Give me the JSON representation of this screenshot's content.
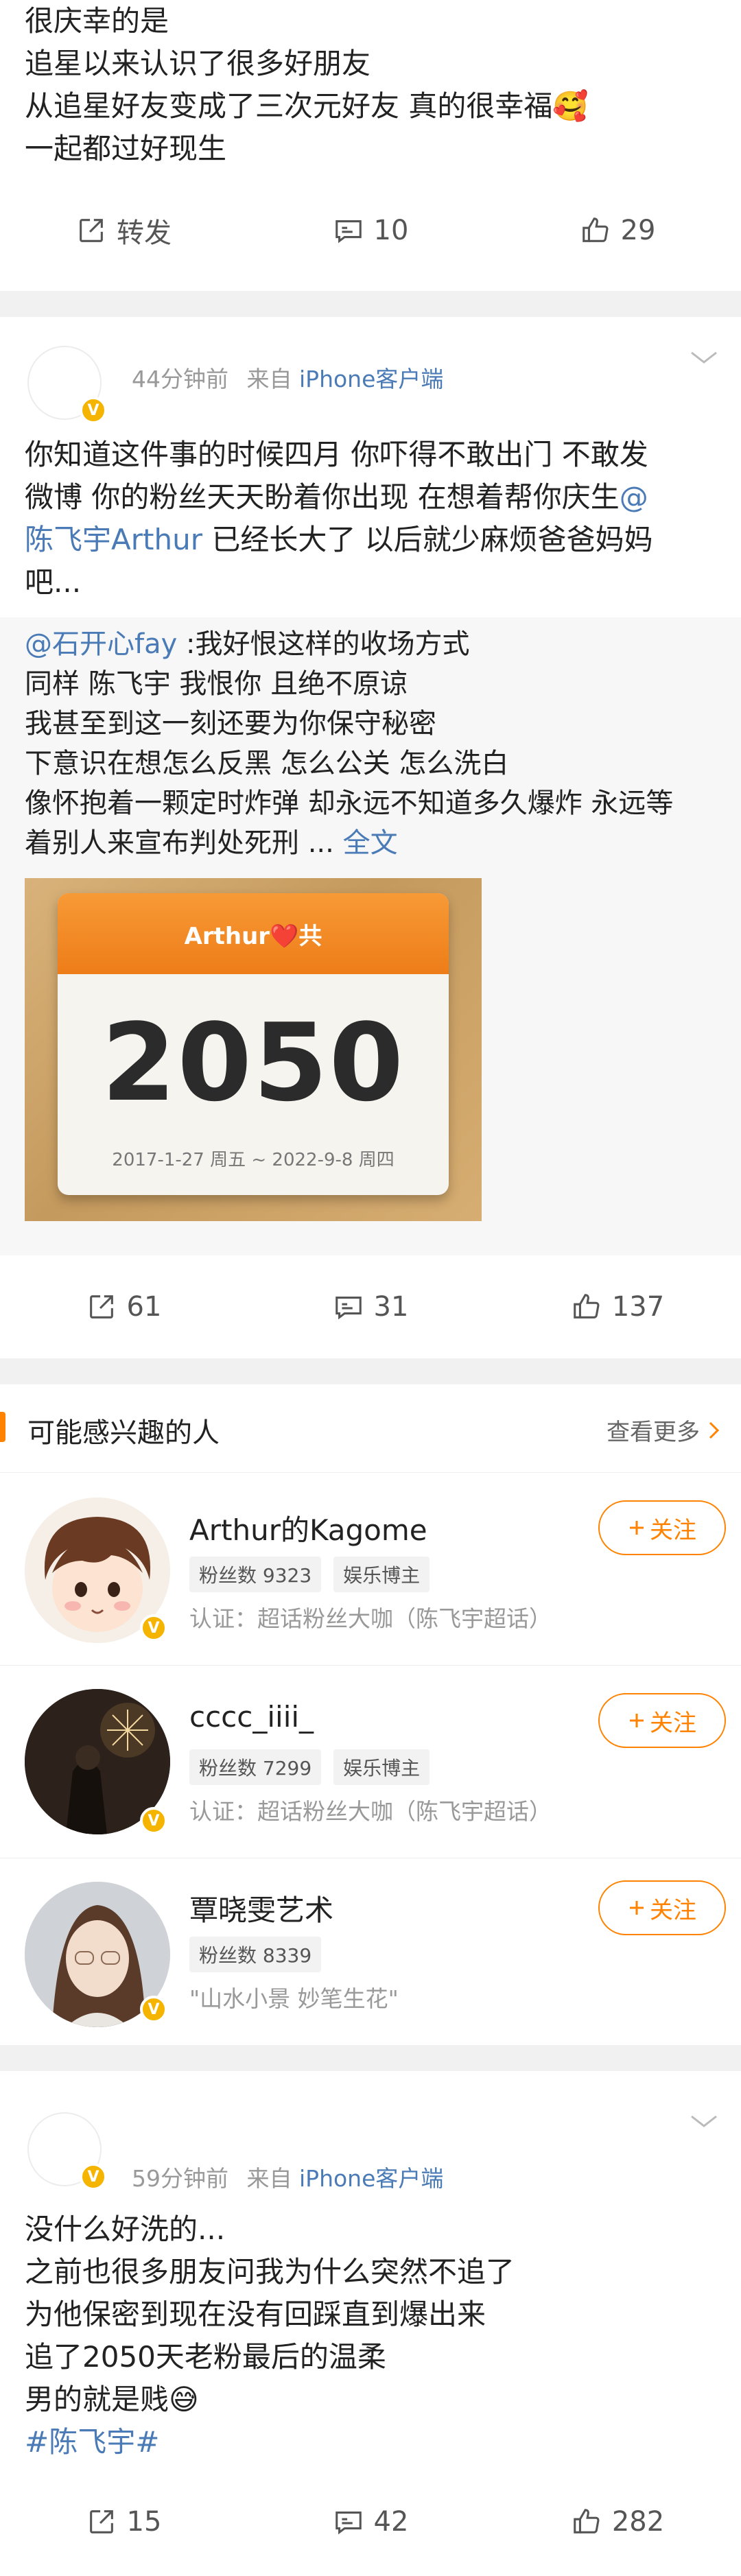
{
  "post1": {
    "lines": [
      "很庆幸的是",
      "追星以来认识了很多好朋友",
      "从追星好友变成了三次元好友 真的很幸福🥰",
      "一起都过好现生"
    ],
    "actions": {
      "repost_label": "转发",
      "comment_count": "10",
      "like_count": "29"
    }
  },
  "post2": {
    "time": "44分钟前",
    "from_label": "来自",
    "source": "iPhone客户端",
    "lines": [
      {
        "pre": "你知道这件事的时候四月 你吓得不敢出门 不敢发",
        "link": ""
      },
      {
        "pre": "微博 你的粉丝天天盼着你出现 在想着帮你庆生",
        "link": "@"
      },
      {
        "pre": "",
        "link": "陈飞宇Arthur",
        "post": " 已经长大了 以后就少麻烦爸爸妈妈"
      },
      {
        "pre": "吧...",
        "link": ""
      }
    ],
    "quote": {
      "author": "@石开心fay",
      "first_line": " :我好恨这样的收场方式",
      "lines": [
        "同样 陈飞宇 我恨你 且绝不原谅",
        "我甚至到这一刻还要为你保守秘密",
        "下意识在想怎么反黑 怎么公关 怎么洗白",
        "像怀抱着一颗定时炸弹 却永远不知道多久爆炸 永远等"
      ],
      "last_line": "着别人来宣布判处死刑 ... ",
      "full_text": "全文",
      "calendar": {
        "title": "Arthur❤️共",
        "number": "2050",
        "dates": "2017-1-27 周五 ~ 2022-9-8 周四"
      }
    },
    "actions": {
      "repost_count": "61",
      "comment_count": "31",
      "like_count": "137"
    }
  },
  "suggest": {
    "title": "可能感兴趣的人",
    "see_more": "查看更多",
    "users": [
      {
        "name": "Arthur的Kagome",
        "followers": "粉丝数 9323",
        "tag2": "娱乐博主",
        "verify": "认证：超话粉丝大咖（陈飞宇超话）",
        "follow": "关注"
      },
      {
        "name": "cccc_iiii_",
        "followers": "粉丝数 7299",
        "tag2": "娱乐博主",
        "verify": "认证：超话粉丝大咖（陈飞宇超话）",
        "follow": "关注"
      },
      {
        "name": "覃晓雯艺术",
        "followers": "粉丝数 8339",
        "tag2": "",
        "verify": "\"山水小景 妙笔生花\"",
        "follow": "关注"
      }
    ]
  },
  "post3": {
    "time": "59分钟前",
    "from_label": "来自",
    "source": "iPhone客户端",
    "lines": [
      "没什么好洗的...",
      "之前也很多朋友问我为什么突然不追了",
      "为他保密到现在没有回踩直到爆出来",
      "追了2050天老粉最后的温柔",
      "男的就是贱😅"
    ],
    "hashtag": "#陈飞宇#",
    "actions": {
      "repost_count": "15",
      "comment_count": "42",
      "like_count": "282"
    }
  },
  "colors": {
    "accent": "#ff8200",
    "link": "#4a7bb6",
    "badge": "#f5b400"
  },
  "icons": [
    "repost-icon",
    "comment-icon",
    "like-icon",
    "chevron-down-icon",
    "chevron-right-icon",
    "plus-icon",
    "verified-badge-icon"
  ]
}
